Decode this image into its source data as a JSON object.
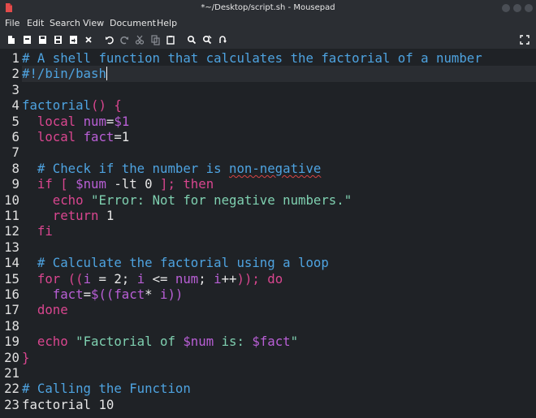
{
  "window": {
    "title": "*~/Desktop/script.sh - Mousepad"
  },
  "menu": {
    "items": [
      "File",
      "Edit",
      "Search",
      "View",
      "Document",
      "Help"
    ]
  },
  "toolbar": {
    "icons": [
      "new-document-icon",
      "new-window-icon",
      "open-icon",
      "save-icon",
      "save-as-icon",
      "revert-icon",
      "close-icon",
      "undo-icon",
      "redo-icon",
      "cut-icon",
      "copy-icon",
      "paste-icon",
      "find-icon",
      "find-replace-icon",
      "go-to-line-icon",
      "fullscreen-icon"
    ]
  },
  "editor": {
    "line_numbers": [
      "1",
      "2",
      "3",
      "4",
      "5",
      "6",
      "7",
      "8",
      "9",
      "10",
      "11",
      "12",
      "13",
      "14",
      "15",
      "16",
      "17",
      "18",
      "19",
      "20",
      "21",
      "22",
      "23"
    ],
    "current_line": 2,
    "lines": [
      [
        {
          "t": "comment",
          "v": "# A shell function that calculates the factorial of a number"
        }
      ],
      [
        {
          "t": "comment",
          "v": "#!/bin/bash"
        }
      ],
      [],
      [
        {
          "t": "fn",
          "v": "factorial"
        },
        {
          "t": "kw",
          "v": "()"
        },
        {
          "t": "plain",
          "v": " "
        },
        {
          "t": "kw",
          "v": "{"
        }
      ],
      [
        {
          "t": "plain",
          "v": "  "
        },
        {
          "t": "kw",
          "v": "local"
        },
        {
          "t": "plain",
          "v": " "
        },
        {
          "t": "var",
          "v": "num"
        },
        {
          "t": "plain",
          "v": "="
        },
        {
          "t": "var",
          "v": "$1"
        }
      ],
      [
        {
          "t": "plain",
          "v": "  "
        },
        {
          "t": "kw",
          "v": "local"
        },
        {
          "t": "plain",
          "v": " "
        },
        {
          "t": "var",
          "v": "fact"
        },
        {
          "t": "plain",
          "v": "=1"
        }
      ],
      [],
      [
        {
          "t": "plain",
          "v": "  "
        },
        {
          "t": "comment",
          "v": "# Check if the number is "
        },
        {
          "t": "comment-sq",
          "v": "non-negative"
        }
      ],
      [
        {
          "t": "plain",
          "v": "  "
        },
        {
          "t": "kw",
          "v": "if [ "
        },
        {
          "t": "var",
          "v": "$num"
        },
        {
          "t": "plain",
          "v": " -lt 0 "
        },
        {
          "t": "kw",
          "v": "]; then"
        }
      ],
      [
        {
          "t": "plain",
          "v": "    "
        },
        {
          "t": "kw",
          "v": "echo"
        },
        {
          "t": "plain",
          "v": " "
        },
        {
          "t": "str",
          "v": "\"Error: Not for negative numbers.\""
        }
      ],
      [
        {
          "t": "plain",
          "v": "    "
        },
        {
          "t": "kw",
          "v": "return"
        },
        {
          "t": "plain",
          "v": " 1"
        }
      ],
      [
        {
          "t": "plain",
          "v": "  "
        },
        {
          "t": "kw",
          "v": "fi"
        }
      ],
      [],
      [
        {
          "t": "plain",
          "v": "  "
        },
        {
          "t": "comment",
          "v": "# Calculate the factorial using a loop"
        }
      ],
      [
        {
          "t": "plain",
          "v": "  "
        },
        {
          "t": "kw",
          "v": "for (("
        },
        {
          "t": "var",
          "v": "i"
        },
        {
          "t": "plain",
          "v": " = 2; "
        },
        {
          "t": "var",
          "v": "i"
        },
        {
          "t": "plain",
          "v": " <= "
        },
        {
          "t": "var",
          "v": "num"
        },
        {
          "t": "plain",
          "v": "; "
        },
        {
          "t": "var",
          "v": "i"
        },
        {
          "t": "plain",
          "v": "++"
        },
        {
          "t": "kw",
          "v": ")); do"
        }
      ],
      [
        {
          "t": "plain",
          "v": "    "
        },
        {
          "t": "var",
          "v": "fact"
        },
        {
          "t": "plain",
          "v": "="
        },
        {
          "t": "var",
          "v": "$(("
        },
        {
          "t": "var",
          "v": "fact"
        },
        {
          "t": "plain",
          "v": "* "
        },
        {
          "t": "var",
          "v": "i"
        },
        {
          "t": "var",
          "v": "))"
        }
      ],
      [
        {
          "t": "plain",
          "v": "  "
        },
        {
          "t": "kw",
          "v": "done"
        }
      ],
      [],
      [
        {
          "t": "plain",
          "v": "  "
        },
        {
          "t": "kw",
          "v": "echo"
        },
        {
          "t": "plain",
          "v": " "
        },
        {
          "t": "str",
          "v": "\"Factorial of "
        },
        {
          "t": "var",
          "v": "$num"
        },
        {
          "t": "str",
          "v": " is: "
        },
        {
          "t": "var",
          "v": "$fact"
        },
        {
          "t": "str",
          "v": "\""
        }
      ],
      [
        {
          "t": "kw",
          "v": "}"
        }
      ],
      [],
      [
        {
          "t": "comment",
          "v": "# Calling the Function"
        }
      ],
      [
        {
          "t": "plain",
          "v": "factorial 10"
        }
      ]
    ]
  },
  "colors": {
    "comment": "#4ea3e0",
    "keyword": "#d9468f",
    "variable": "#b95fd6",
    "string": "#7fd0b0",
    "text": "#e6e6e6",
    "background": "#1f2226"
  }
}
